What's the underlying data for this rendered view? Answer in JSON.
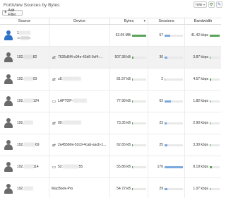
{
  "widget": {
    "title": "FortiView Sources by Bytes"
  },
  "controls": {
    "timeframe": "now",
    "timeframe_chevron": "▾",
    "refresh_glyph": "⟳",
    "settings_glyph": "✎"
  },
  "filter": {
    "plus": "+",
    "label": "Add Filter"
  },
  "table": {
    "headers": {
      "source": "Source",
      "device": "Device",
      "bytes": "Bytes",
      "sessions": "Sessions",
      "bandwidth": "Bandwidth"
    },
    "sort_indicator": "▾",
    "rows": [
      {
        "source": "1",
        "source_blurred": "▒▒▒▒▒",
        "source_sub": "10.▒▒▒▒1",
        "device_icon": "",
        "device": "",
        "bytes": "52.05 MB",
        "bytes_pct": 100,
        "sessions": "57",
        "sessions_pct": 32,
        "bandwidth": "41.42 kbps",
        "bandwidth_pct": 100
      },
      {
        "source": "192.",
        "source_blurred": "▒▒▒▒",
        "source_suffix": "82",
        "device_icon": "⇄",
        "device": "7635d6f4-c94e-43d6-9cf4-...",
        "bytes": "507.38 kB",
        "bytes_pct": 10,
        "sessions": "30",
        "sessions_pct": 17,
        "bandwidth": "3.87 kbps",
        "bandwidth_pct": 10
      },
      {
        "source": "192.",
        "source_blurred": "▒▒▒▒",
        "source_suffix": "03",
        "device_icon": "⇄",
        "device": "c8:",
        "device_blurred": "▒▒▒▒▒▒▒▒",
        "bytes": "81.57 kB",
        "bytes_pct": 2,
        "sessions": "2",
        "sessions_pct": 1,
        "bandwidth": "4.57 kbps",
        "bandwidth_pct": 11
      },
      {
        "source": "192.",
        "source_blurred": "▒▒▒▒",
        "source_suffix": "124",
        "device_icon": "▭",
        "device": "LAPTOP-",
        "device_blurred": "▒▒▒▒▒▒",
        "bytes": "77.99 kB",
        "bytes_pct": 2,
        "sessions": "62",
        "sessions_pct": 35,
        "bandwidth": "1.82 kbps",
        "bandwidth_pct": 4
      },
      {
        "source": "192.",
        "source_blurred": "▒▒▒▒",
        "source_suffix": "",
        "device_icon": "⇄",
        "device": "00:",
        "device_blurred": "▒▒▒▒▒▒▒▒",
        "bytes": "73.35 kB",
        "bytes_pct": 1,
        "sessions": "23",
        "sessions_pct": 13,
        "bandwidth": "2.90 kbps",
        "bandwidth_pct": 7
      },
      {
        "source": "192.",
        "source_blurred": "▒▒▒▒▒",
        "source_suffix": "69",
        "device_icon": "⇄",
        "device": "2a45560e-52c9-4cab-aacb-1...",
        "bytes": "62.65 kB",
        "bytes_pct": 1,
        "sessions": "25",
        "sessions_pct": 14,
        "bandwidth": "3.30 kbps",
        "bandwidth_pct": 8
      },
      {
        "source": "192.",
        "source_blurred": "▒▒▒▒",
        "source_suffix": "114",
        "device_icon": "▭",
        "device": "52:",
        "device_blurred": "▒▒▒▒▒▒▒",
        "device_suffix": "55",
        "bytes": "55.86 kB",
        "bytes_pct": 1,
        "sessions": "176",
        "sessions_pct": 100,
        "bandwidth": "8.19 kbps",
        "bandwidth_pct": 20
      },
      {
        "source": "192.",
        "source_blurred": "▒▒▒▒",
        "source_suffix": "",
        "device_icon": "",
        "device": "MacBook-Pro",
        "bytes": "54.72 kB",
        "bytes_pct": 1,
        "sessions": "29",
        "sessions_pct": 16,
        "bandwidth": "1.07 kbps",
        "bandwidth_pct": 3
      }
    ]
  },
  "colors": {
    "bytes_bar": "#5aa35a",
    "sessions_bar": "#7ca9dd",
    "bandwidth_bar": "#5aa35a",
    "shaded_row": "#f2f2f2",
    "top_source_avatar": "#2f73c8",
    "avatar": "#6b6b6b"
  },
  "icons": {
    "avatar": "user-icon",
    "device_generic": "network-device-icon",
    "device_laptop": "laptop-icon",
    "device_mac": "apple-icon",
    "add": "plus-icon",
    "refresh": "refresh-icon",
    "settings": "wrench-icon"
  }
}
